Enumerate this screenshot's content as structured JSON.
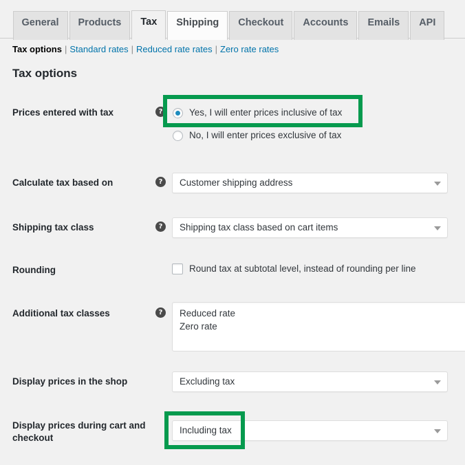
{
  "tabs": [
    {
      "label": "General",
      "state": "inactive"
    },
    {
      "label": "Products",
      "state": "inactive"
    },
    {
      "label": "Tax",
      "state": "active"
    },
    {
      "label": "Shipping",
      "state": "hovered"
    },
    {
      "label": "Checkout",
      "state": "inactive"
    },
    {
      "label": "Accounts",
      "state": "inactive"
    },
    {
      "label": "Emails",
      "state": "inactive"
    },
    {
      "label": "API",
      "state": "inactive"
    }
  ],
  "subnav": {
    "current": "Tax options",
    "sep": "|",
    "links": [
      "Standard rates",
      "Reduced rate rates",
      "Zero rate rates"
    ]
  },
  "heading": "Tax options",
  "help_glyph": "?",
  "rows": {
    "prices_entered_with_tax": {
      "label": "Prices entered with tax",
      "option_yes": "Yes, I will enter prices inclusive of tax",
      "option_no": "No, I will enter prices exclusive of tax",
      "selected": "Yes, I will enter prices inclusive of tax"
    },
    "calculate_tax_based_on": {
      "label": "Calculate tax based on",
      "value": "Customer shipping address"
    },
    "shipping_tax_class": {
      "label": "Shipping tax class",
      "value": "Shipping tax class based on cart items"
    },
    "rounding": {
      "label": "Rounding",
      "checkbox_label": "Round tax at subtotal level, instead of rounding per line",
      "checked": false
    },
    "additional_tax_classes": {
      "label": "Additional tax classes",
      "value": "Reduced rate\nZero rate"
    },
    "display_prices_in_shop": {
      "label": "Display prices in the shop",
      "value": "Excluding tax"
    },
    "display_prices_cart_checkout": {
      "label": "Display prices during cart and checkout",
      "value": "Including tax"
    }
  },
  "colors": {
    "highlight_green": "#069a4e",
    "link_blue": "#0073aa",
    "radio_blue": "#1e8cbe",
    "page_background": "#f1f1f1"
  }
}
